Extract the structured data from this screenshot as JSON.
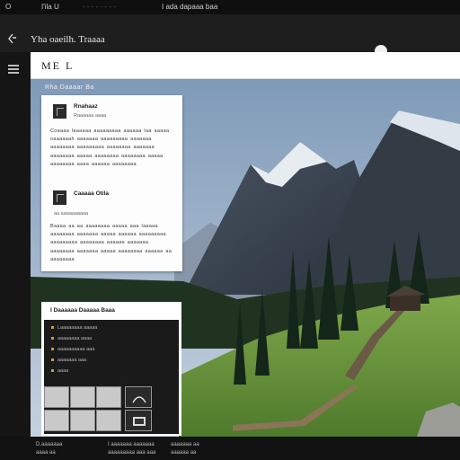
{
  "topbar": {
    "left_icon": "circle-icon",
    "items": [
      "O",
      "I'ila U",
      "- - - - - - - -",
      "I ada dapaaa baa"
    ]
  },
  "header": {
    "brand_icon": "diamond-arrow-icon",
    "title": "Yha oaeilh. Traaaa",
    "avatar_icon": "user-avatar-icon"
  },
  "toolbar": {
    "logo_text": "ME L",
    "menu_icon": "hamburger-menu-icon"
  },
  "breadcrumb": "Rha Daaaar Ba",
  "card": {
    "section1": {
      "heading": "Rnahaaz",
      "sub": "Raaaaaa aaaa",
      "paragraph": "Coaaaa laaaaaa aaaaaaaaa aaaaaa laa aaaaa oaaaaaah aaaaaaa aaaaaaaaa aaaaaaa aaaaaaaa aaaaaaaaa aaaaaaaa aaaaaaa aaaaaaaa aaaaa aaaaaaaa aaaaaaaa aaaaa aaaaaaaa aaaa aaaaaa aaaaaaaa"
    },
    "section2": {
      "heading": "Caaaaa Otila",
      "sub": "aa aaaaaaaaaa",
      "paragraph": "Baaaa aa aa aaaaaaaa aaaaa aaa laaaaa aaaaaaaa aaaaaaa aaaaa aaaaaa aaaaaaaaa aaaaaaaaa aaaaaaaa aaaaaa aaaaaaa aaaaaaaa aaaaaaa aaaaa aaaaaaaa aaaaaa aa aaaaaaaa"
    }
  },
  "panel": {
    "title": "I Daaaaaa Daaaaa Baaa",
    "rows": [
      "Laaaaaaaa aaaaa",
      "aaaaaaaa aaaa",
      "aaaaaaaaaa aaa",
      "aaaaaaa aaa",
      "aaaa"
    ],
    "thumbs": 6
  },
  "bottombar": {
    "left1": "D.aaaaaaa",
    "left2": "aaaa aa",
    "mid1": "I aaaaaaa aaaaaaa",
    "mid2": "aaaaaaaaa aaa aaa",
    "right1": "aaaaaaa aa",
    "right2": "aaaaaa aa"
  },
  "colors": {
    "accent": "#c8a030",
    "panel_bg": "#1a1a1a",
    "sky": "#8fa8c4"
  }
}
